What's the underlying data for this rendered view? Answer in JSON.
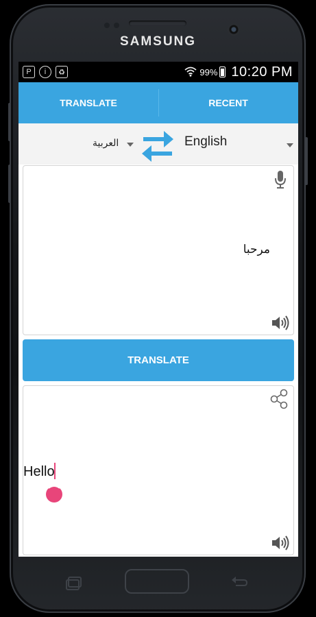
{
  "device": {
    "brand": "SAMSUNG"
  },
  "status_bar": {
    "battery": "99%",
    "time": "10:20 PM"
  },
  "tabs": [
    {
      "label": "TRANSLATE"
    },
    {
      "label": "RECENT"
    }
  ],
  "languages": {
    "source": "العربية",
    "target": "English"
  },
  "source_text": "مرحبا",
  "translate_button": "TRANSLATE",
  "result_text": "Hello",
  "colors": {
    "accent": "#3aa5e0",
    "cursor": "#e8457a"
  },
  "icons": [
    "microphone-icon",
    "speaker-icon",
    "share-icon",
    "swap-icon"
  ]
}
